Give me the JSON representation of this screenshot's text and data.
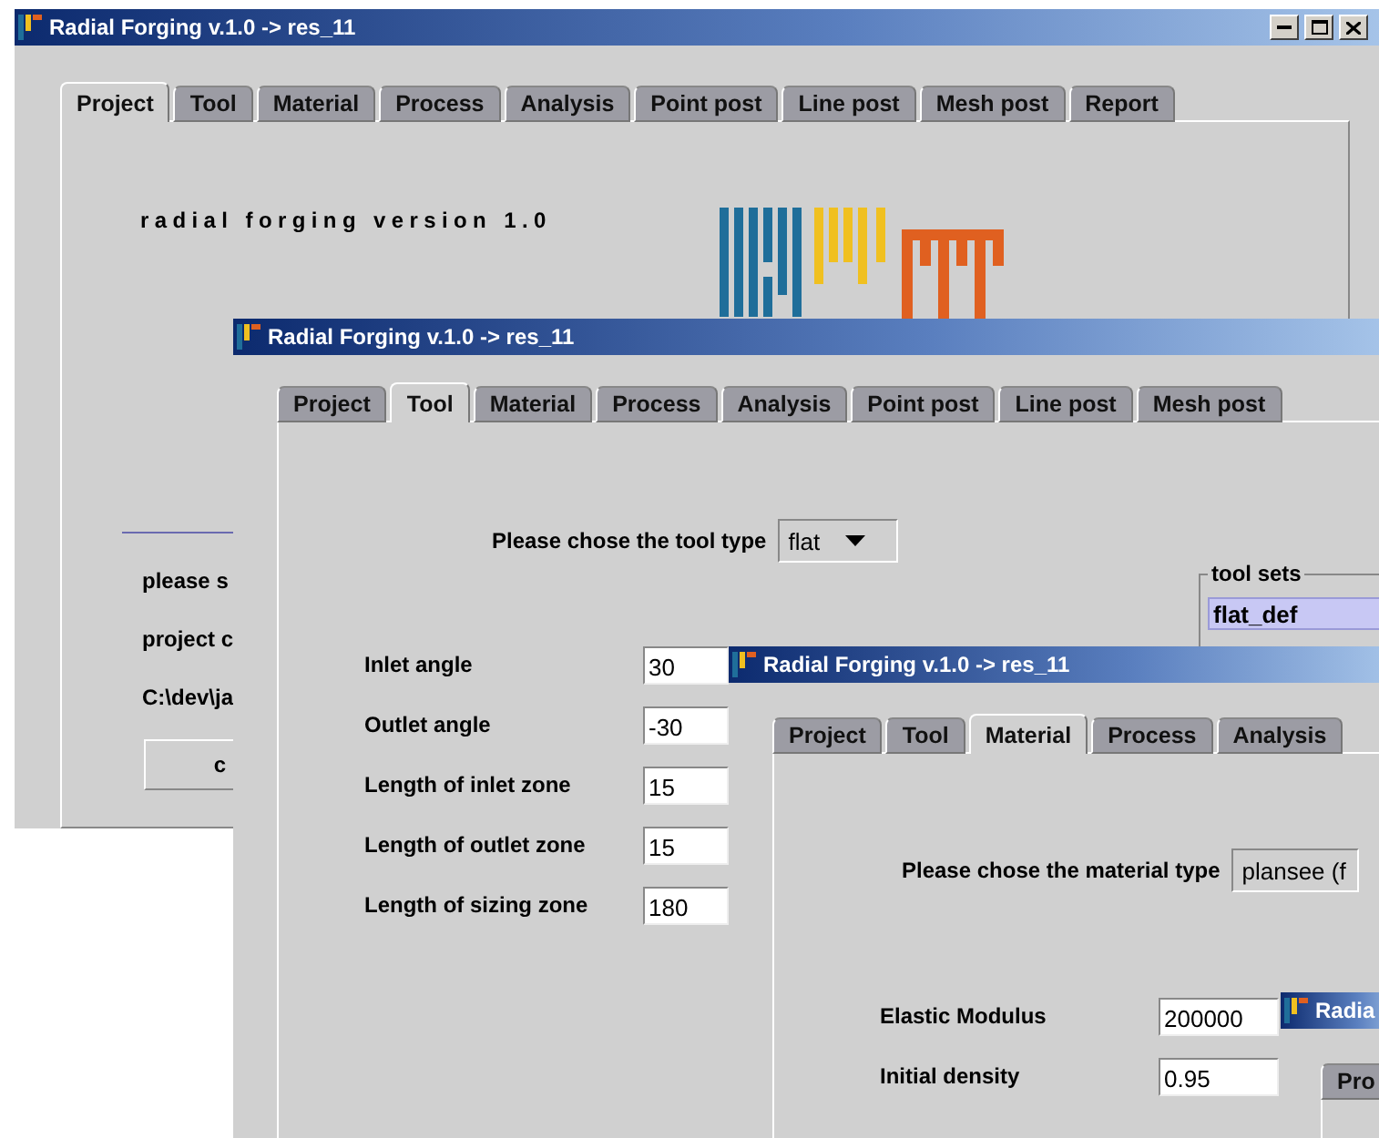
{
  "windows": [
    {
      "kind": "project",
      "title": "Radial Forging v.1.0 -> res_11",
      "controls": true,
      "tabs": [
        {
          "label": "Project",
          "selected": true
        },
        {
          "label": "Tool",
          "selected": false
        },
        {
          "label": "Material",
          "selected": false
        },
        {
          "label": "Process",
          "selected": false
        },
        {
          "label": "Analysis",
          "selected": false
        },
        {
          "label": "Point post",
          "selected": false
        },
        {
          "label": "Line post",
          "selected": false
        },
        {
          "label": "Mesh post",
          "selected": false
        },
        {
          "label": "Report",
          "selected": false
        }
      ],
      "heading": "radial forging version 1.0",
      "lines": [
        "please s",
        "project c",
        "C:\\dev\\ja"
      ],
      "button": "c"
    },
    {
      "kind": "tool",
      "title": "Radial Forging v.1.0 -> res_11",
      "controls": false,
      "tabs": [
        {
          "label": "Project",
          "selected": false
        },
        {
          "label": "Tool",
          "selected": true
        },
        {
          "label": "Material",
          "selected": false
        },
        {
          "label": "Process",
          "selected": false
        },
        {
          "label": "Analysis",
          "selected": false
        },
        {
          "label": "Point post",
          "selected": false
        },
        {
          "label": "Line post",
          "selected": false
        },
        {
          "label": "Mesh post",
          "selected": false
        }
      ],
      "type_label": "Please chose the tool type",
      "type_value": "flat",
      "tool_sets": {
        "title": "tool sets",
        "items": [
          {
            "label": "flat_def",
            "selected": true
          }
        ]
      },
      "fields": [
        {
          "label": "Inlet angle",
          "value": "30"
        },
        {
          "label": "Outlet angle",
          "value": "-30"
        },
        {
          "label": "Length of inlet zone",
          "value": "15"
        },
        {
          "label": "Length of outlet zone",
          "value": "15"
        },
        {
          "label": "Length of sizing zone",
          "value": "180"
        }
      ]
    },
    {
      "kind": "material",
      "title": "Radial Forging v.1.0 -> res_11",
      "controls": false,
      "tabs": [
        {
          "label": "Project",
          "selected": false
        },
        {
          "label": "Tool",
          "selected": false
        },
        {
          "label": "Material",
          "selected": true
        },
        {
          "label": "Process",
          "selected": false
        },
        {
          "label": "Analysis",
          "selected": false
        }
      ],
      "type_label": "Please chose the material type",
      "type_value": "plansee (f",
      "fields": [
        {
          "label": "Elastic Modulus",
          "value": "200000"
        },
        {
          "label": "Initial density",
          "value": "0.95"
        }
      ]
    },
    {
      "kind": "tabs_only",
      "title": "Radia",
      "controls": false,
      "tabs": [
        {
          "label": "Pro",
          "selected": false
        }
      ]
    }
  ]
}
